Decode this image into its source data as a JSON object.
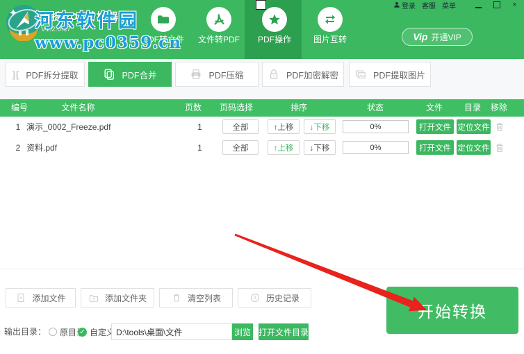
{
  "watermark": {
    "title": "河东软件园",
    "url": "www.pc0359.cn"
  },
  "header": {
    "app_title": "迅捷PDF转换器",
    "version": "V1.2.0.17",
    "nav": [
      {
        "label": "PDF转文件",
        "icon": "folder-icon"
      },
      {
        "label": "文件转PDF",
        "icon": "pdf-file-icon"
      },
      {
        "label": "PDF操作",
        "icon": "star-icon",
        "active": true
      },
      {
        "label": "图片互转",
        "icon": "swap-icon"
      }
    ],
    "account": {
      "login": "登录",
      "service": "客服",
      "menu": "菜单"
    },
    "vip": {
      "logo": "Vip",
      "label": "开通VIP"
    },
    "window_controls": {
      "close": "×"
    }
  },
  "tool_tabs": [
    {
      "label": "PDF拆分提取",
      "icon": "split-icon"
    },
    {
      "label": "PDF合并",
      "icon": "merge-pages-icon",
      "active": true
    },
    {
      "label": "PDF压缩",
      "icon": "zip-compress-icon"
    },
    {
      "label": "PDF加密解密",
      "icon": "lock-icon"
    },
    {
      "label": "PDF提取图片",
      "icon": "extract-images-icon"
    }
  ],
  "table": {
    "headers": [
      "编号",
      "文件名称",
      "页数",
      "页码选择",
      "排序",
      "状态",
      "文件",
      "目录",
      "移除"
    ],
    "rows": [
      {
        "index": "1",
        "filename": "演示_0002_Freeze.pdf",
        "pages": "1",
        "page_select": "全部",
        "move_up": "↑上移",
        "move_down": "↓下移",
        "progress": "0%",
        "open_label": "打开文件",
        "locate_label": "定位文件"
      },
      {
        "index": "2",
        "filename": "资料.pdf",
        "pages": "1",
        "page_select": "全部",
        "move_up": "↑上移",
        "move_down": "↓下移",
        "progress": "0%",
        "open_label": "打开文件",
        "locate_label": "定位文件"
      }
    ]
  },
  "actions": {
    "add_file": "添加文件",
    "add_folder": "添加文件夹",
    "clear_list": "清空列表",
    "history": "历史记录"
  },
  "output": {
    "label": "输出目录：",
    "radio_original": "原目录",
    "radio_custom": "自定义",
    "custom_check": "✓",
    "path": "D:\\tools\\桌面\\文件",
    "browse": "浏览",
    "open_dir": "打开文件目录"
  },
  "convert_label": "开始转换",
  "colors": {
    "primary_green": "#3cb860",
    "active_nav_green": "#2da050",
    "table_header_green": "#3fbe63",
    "convert_green": "#42bc64",
    "watermark_blue": "#1a9ed9",
    "arrow_red": "#e8221c"
  }
}
